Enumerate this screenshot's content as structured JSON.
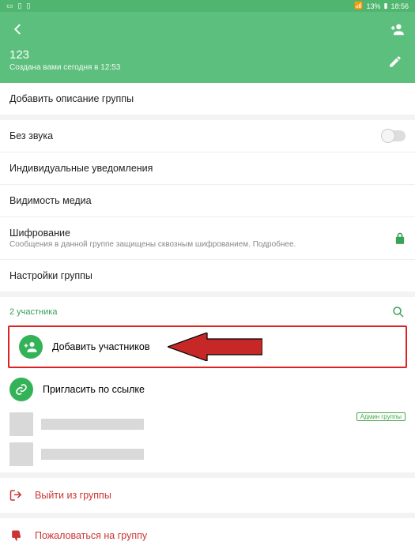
{
  "statusbar": {
    "battery": "13%",
    "time": "18:56"
  },
  "header": {
    "title": "123",
    "subtitle": "Создана вами сегодня в 12:53"
  },
  "rows": {
    "add_description": "Добавить описание группы",
    "mute": "Без звука",
    "custom_notif": "Индивидуальные уведомления",
    "media_visibility": "Видимость медиа",
    "encryption_title": "Шифрование",
    "encryption_sub": "Сообщения в данной группе защищены сквозным шифрованием. Подробнее.",
    "group_settings": "Настройки группы"
  },
  "participants": {
    "count_label": "2 участника",
    "add_label": "Добавить участников",
    "invite_label": "Пригласить по ссылке",
    "admin_badge": "Админ группы"
  },
  "actions": {
    "exit": "Выйти из группы",
    "report": "Пожаловаться на группу"
  }
}
